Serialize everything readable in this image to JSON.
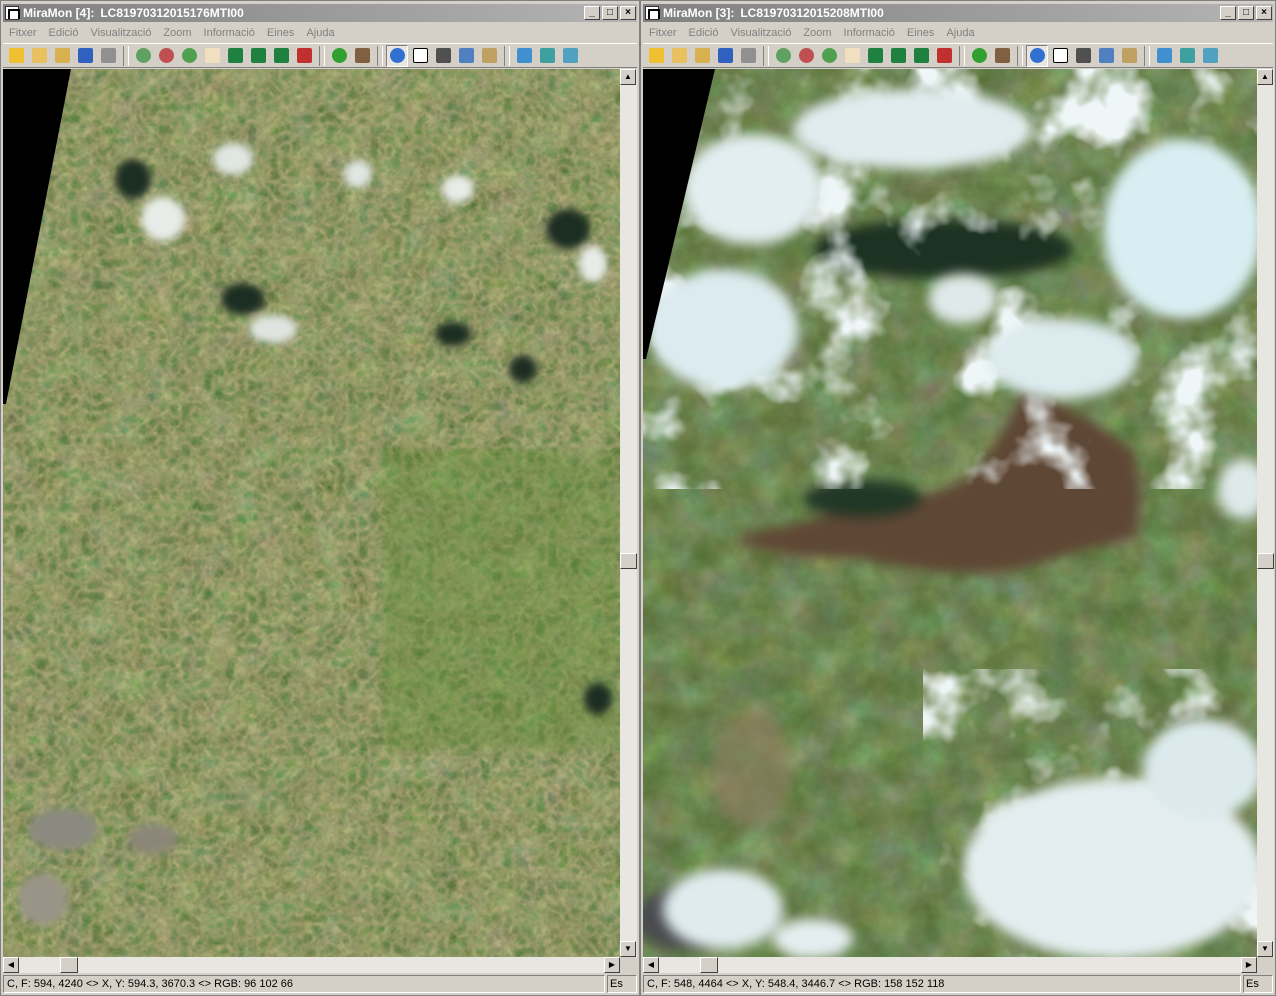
{
  "windows": [
    {
      "title_app": "MiraMon [4]:",
      "title_file": "LC81970312015176MTI00",
      "menu": [
        "Fitxer",
        "Edició",
        "Visualització",
        "Zoom",
        "Informació",
        "Eines",
        "Ajuda"
      ],
      "status": "C, F: 594, 4240 <> X, Y: 594.3, 3670.3 <> RGB:  96 102 66",
      "status_lang": "Es"
    },
    {
      "title_app": "MiraMon [3]:",
      "title_file": "LC81970312015208MTI00",
      "menu": [
        "Fitxer",
        "Edició",
        "Visualització",
        "Zoom",
        "Informació",
        "Eines",
        "Ajuda"
      ],
      "status": "C, F: 548, 4464 <> X, Y: 548.4, 3446.7 <> RGB:  158 152 118",
      "status_lang": "Es"
    }
  ],
  "window_buttons": {
    "minimize": "_",
    "maximize": "□",
    "close": "×"
  },
  "scroll_glyphs": {
    "up": "▲",
    "down": "▼",
    "left": "◀",
    "right": "▶"
  },
  "toolbar_icons": [
    "new-icon",
    "open-icon",
    "open-query-icon",
    "save-icon",
    "print-icon",
    "zoom-in-icon",
    "zoom-out-icon",
    "zoom-window-icon",
    "pan-hand-icon",
    "zoom-full-icon",
    "zoom-previous-icon",
    "zoom-next-icon",
    "zoom-layer-icon",
    "refresh-icon",
    "tools-icon",
    "info-icon",
    "select-pointer-icon",
    "measure-icon",
    "profile-icon",
    "edit-icon",
    "export-icon",
    "legend-icon",
    "layers-icon"
  ],
  "colors": {
    "vegetation": "#4e6b2f",
    "cloud": "#dbe8ec",
    "burn_scar": "#5b4a3a",
    "nodata": "#000000"
  }
}
